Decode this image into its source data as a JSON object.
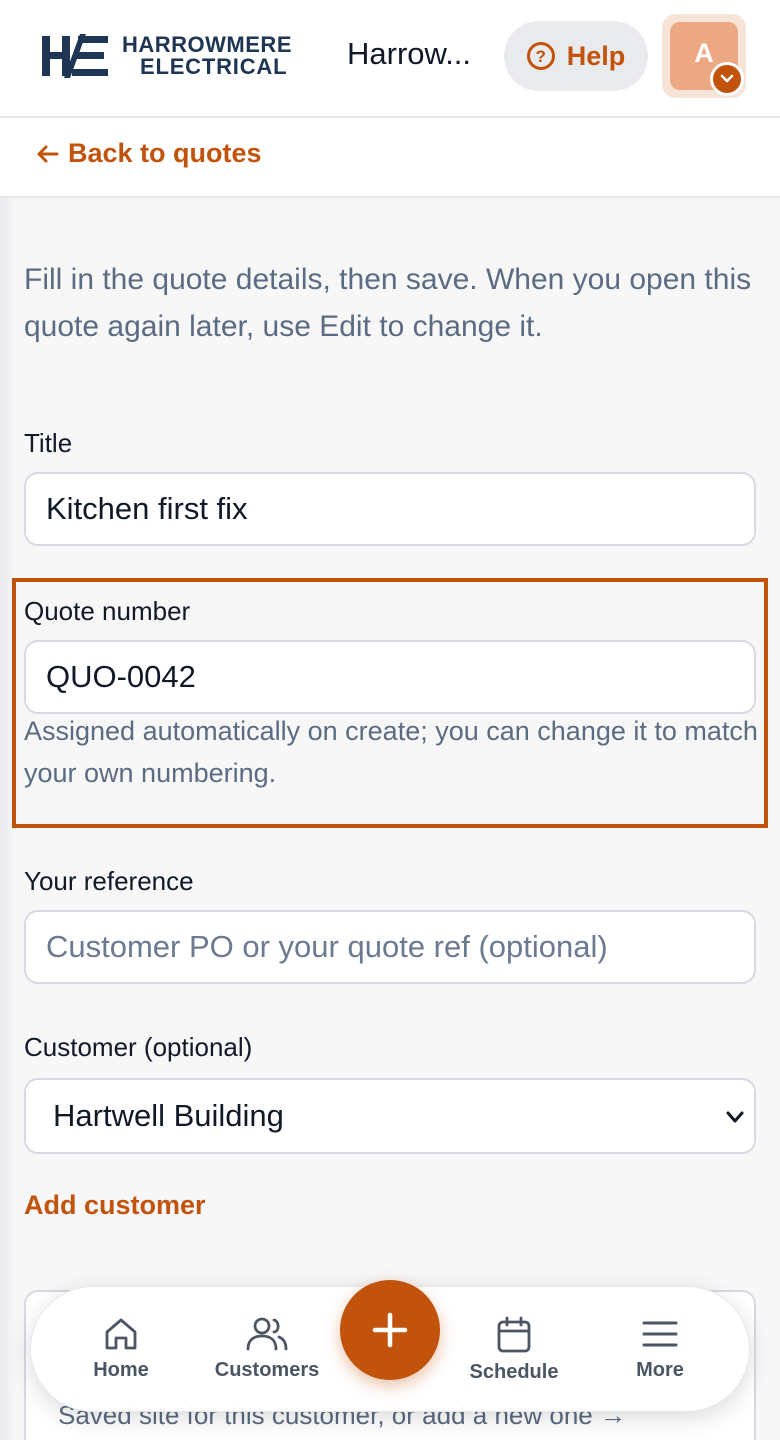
{
  "header": {
    "logo_line1": "HARROWMERE",
    "logo_line2": "ELECTRICAL",
    "org_name": "Harrow...",
    "help_label": "Help",
    "avatar_initial": "A"
  },
  "back_link": "Back to quotes",
  "form": {
    "intro": "Fill in the quote details, then save. When you open this quote again later, use Edit to change it.",
    "title_label": "Title",
    "title_value": "Kitchen first fix",
    "quote_number_label": "Quote number",
    "quote_number_value": "QUO-0042",
    "quote_number_hint": "Assigned automatically on create; you can change it to match your own numbering.",
    "reference_label": "Your reference",
    "reference_placeholder": "Customer PO or your quote ref (optional)",
    "customer_label": "Customer (optional)",
    "customer_selected": "Hartwell Building",
    "add_customer": "Add customer",
    "site_hint": "Saved site for this customer, or add a new one →"
  },
  "nav": {
    "items": [
      {
        "label": "Home",
        "icon": "home-icon"
      },
      {
        "label": "Customers",
        "icon": "users-icon"
      },
      {
        "label": "Schedule",
        "icon": "calendar-icon"
      },
      {
        "label": "More",
        "icon": "menu-icon"
      }
    ],
    "fab_icon": "plus-icon"
  },
  "colors": {
    "accent": "#c2530c",
    "brand_navy": "#1e3553",
    "muted_text": "#5b6b82"
  }
}
